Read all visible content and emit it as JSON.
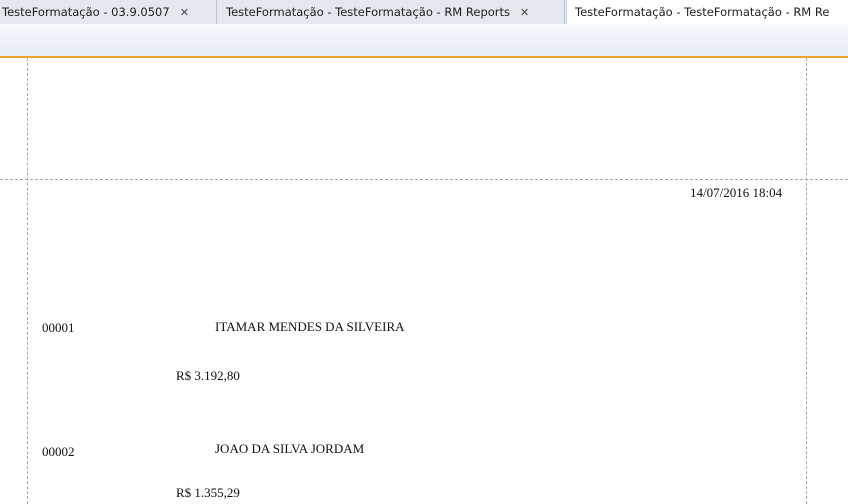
{
  "tabs": [
    {
      "label": "TesteFormatação - 03.9.0507",
      "close": "✕"
    },
    {
      "label": "TesteFormatação - TesteFormatação - RM Reports",
      "close": "✕"
    },
    {
      "label": "TesteFormatação - TesteFormatação - RM Re",
      "active": true
    }
  ],
  "report": {
    "timestamp": "14/07/2016 18:04",
    "rows": [
      {
        "code": "00001",
        "name": "ITAMAR MENDES DA SILVEIRA",
        "amount": "R$ 3.192,80"
      },
      {
        "code": "00002",
        "name": "JOAO DA SILVA JORDAM",
        "amount": "R$ 1.355,29"
      }
    ]
  },
  "colors": {
    "accent_line": "#f0a430",
    "tab_strip": "#e3e8ef",
    "guide_line": "#a8a8a8"
  }
}
